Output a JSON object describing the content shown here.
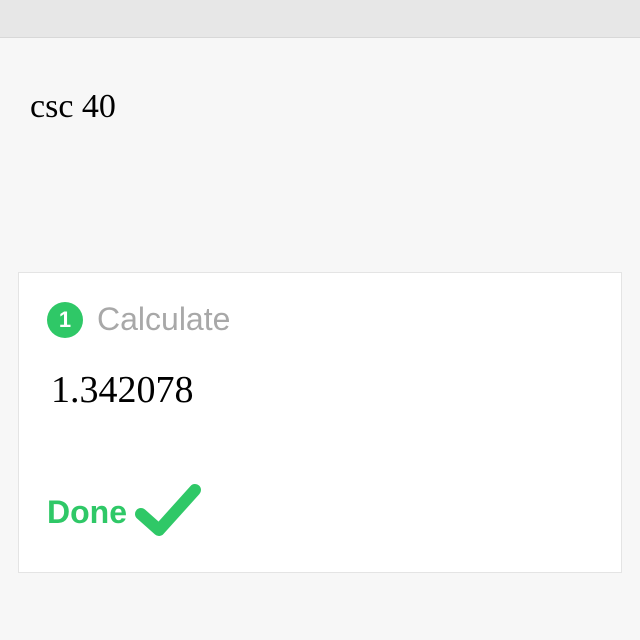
{
  "expression": "csc 40",
  "step": {
    "number": "1",
    "title": "Calculate"
  },
  "result": "1.342078",
  "done_label": "Done",
  "colors": {
    "accent": "#2fc867"
  }
}
